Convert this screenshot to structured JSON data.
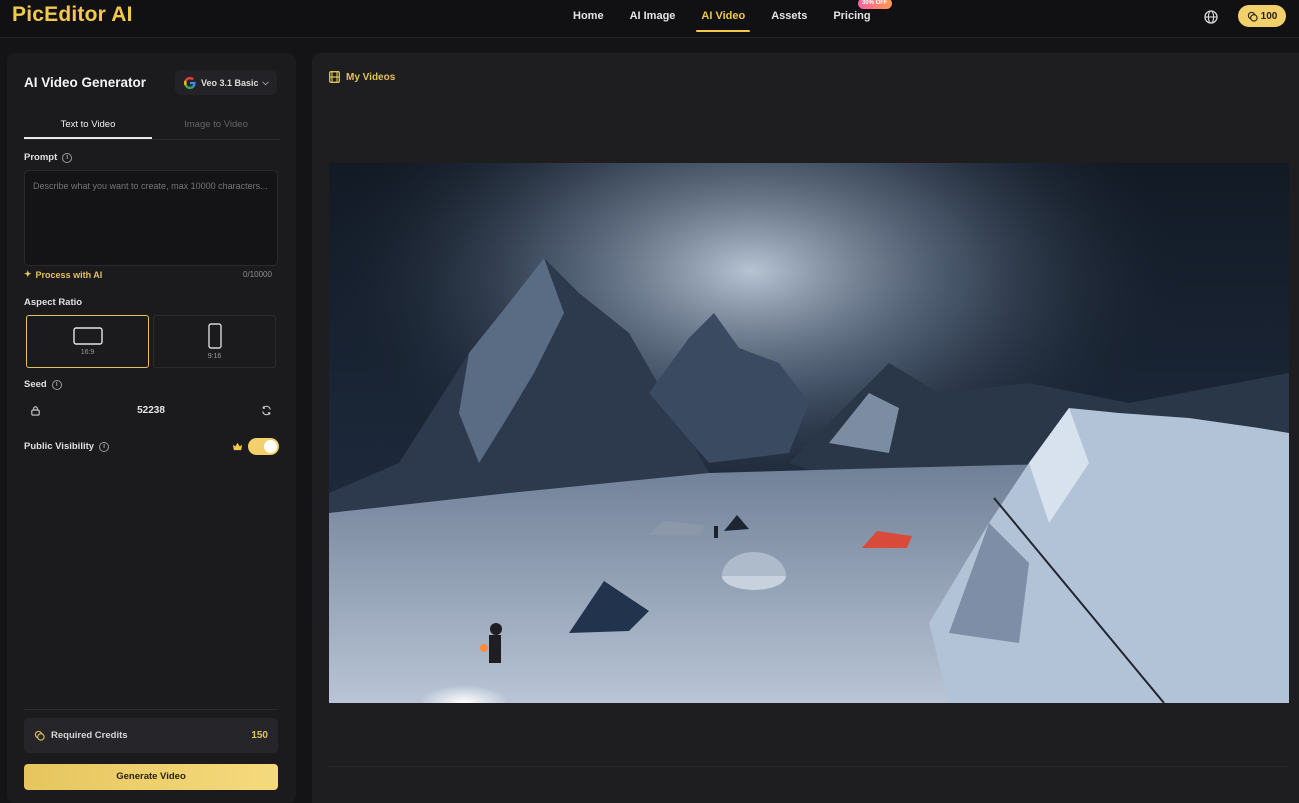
{
  "app": {
    "logo": "PicEditor AI"
  },
  "nav": {
    "items": [
      {
        "label": "Home"
      },
      {
        "label": "AI Image"
      },
      {
        "label": "AI Video"
      },
      {
        "label": "Assets"
      },
      {
        "label": "Pricing",
        "badge": "30% OFF"
      }
    ],
    "active": "AI Video"
  },
  "header": {
    "credits": "100"
  },
  "sidebar": {
    "title": "AI Video Generator",
    "model": "Veo 3.1 Basic",
    "tabs": [
      {
        "label": "Text to Video"
      },
      {
        "label": "Image to Video"
      }
    ],
    "prompt": {
      "label": "Prompt",
      "placeholder": "Describe what you want to create, max 10000 characters...",
      "count": "0/10000",
      "process_label": "Process with AI"
    },
    "aspect": {
      "label": "Aspect Ratio",
      "options": [
        {
          "label": "16:9"
        },
        {
          "label": "9:16"
        }
      ],
      "selected": "16:9"
    },
    "seed": {
      "label": "Seed",
      "value": "52238"
    },
    "visibility": {
      "label": "Public Visibility",
      "enabled": true
    },
    "required_credits": {
      "label": "Required Credits",
      "value": "150"
    },
    "generate_label": "Generate Video"
  },
  "main": {
    "section_title": "My Videos"
  },
  "colors": {
    "accent": "#f2c94c",
    "background": "#141416",
    "panel": "#1b1b1e"
  }
}
